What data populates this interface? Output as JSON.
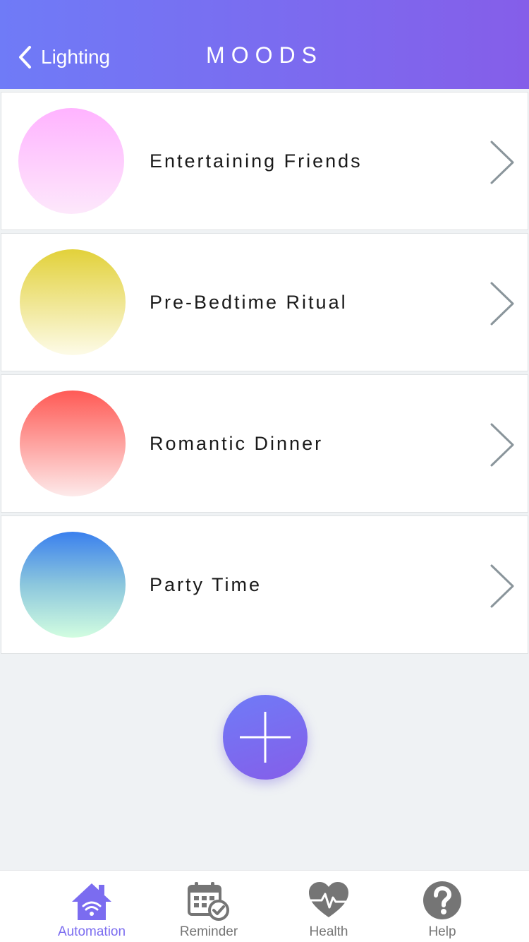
{
  "header": {
    "back_label": "Lighting",
    "title": "MOODS",
    "gradient": [
      "#6f7bf7",
      "#855ee9"
    ]
  },
  "moods": [
    {
      "label": "Entertaining Friends",
      "colors": [
        "#ffb3ff",
        "#fde8fb"
      ]
    },
    {
      "label": "Pre-Bedtime Ritual",
      "colors": [
        "#e2d13a",
        "#fdfbe8"
      ]
    },
    {
      "label": "Romantic Dinner",
      "colors": [
        "#ff5a55",
        "#fdeaea"
      ]
    },
    {
      "label": "Party Time",
      "colors": [
        "#3a80ee",
        "#d2fde0"
      ]
    }
  ],
  "tabs": [
    {
      "label": "Automation",
      "icon": "home-wifi-icon",
      "active": true
    },
    {
      "label": "Reminder",
      "icon": "calendar-check-icon",
      "active": false
    },
    {
      "label": "Health",
      "icon": "heart-pulse-icon",
      "active": false
    },
    {
      "label": "Help",
      "icon": "help-icon",
      "active": false
    }
  ],
  "colors": {
    "accent": "#7b6cf0",
    "icon_gray": "#757575",
    "chevron": "#8a959b",
    "background": "#eff2f4"
  }
}
